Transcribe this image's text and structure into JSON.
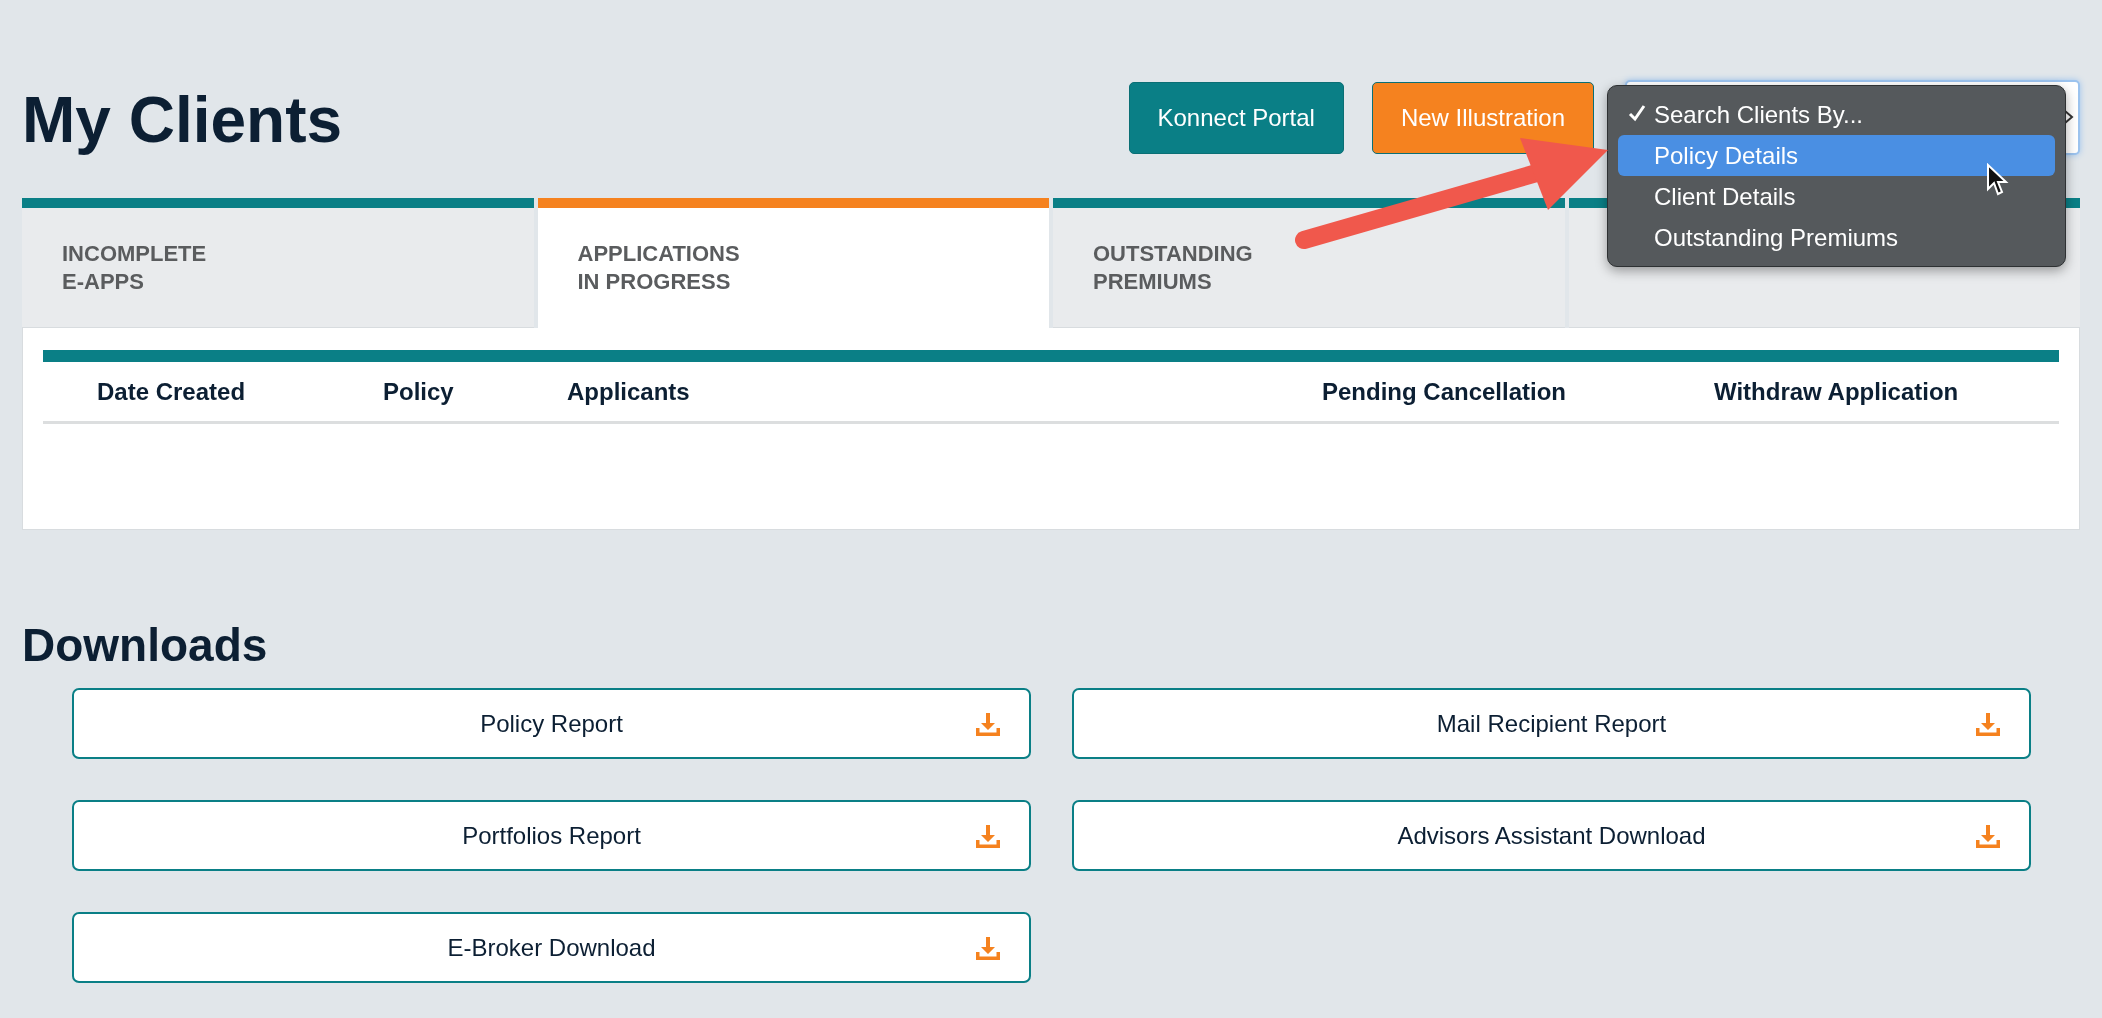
{
  "page": {
    "title": "My Clients"
  },
  "actions": [
    {
      "label": "Konnect Portal",
      "kind": "teal"
    },
    {
      "label": "New Illustration",
      "kind": "orange"
    }
  ],
  "search_menu": {
    "items": [
      {
        "label": "Search Clients By...",
        "checked": true,
        "selected": false
      },
      {
        "label": "Policy Details",
        "checked": false,
        "selected": true
      },
      {
        "label": "Client Details",
        "checked": false,
        "selected": false
      },
      {
        "label": "Outstanding Premiums",
        "checked": false,
        "selected": false
      }
    ]
  },
  "tabs": [
    {
      "label": "INCOMPLETE\nE-APPS",
      "selected": false
    },
    {
      "label": "APPLICATIONS\nIN PROGRESS",
      "selected": true
    },
    {
      "label": "OUTSTANDING\nPREMIUMS",
      "selected": false
    },
    {
      "selected": false
    }
  ],
  "table": {
    "columns": [
      "Date Created",
      "Policy",
      "Applicants",
      "Pending Cancellation",
      "Withdraw Application"
    ]
  },
  "downloads": {
    "title": "Downloads",
    "items": [
      "Policy Report",
      "Mail Recipient Report",
      "Portfolios Report",
      "Advisors Assistant Download",
      "E-Broker Download"
    ]
  }
}
